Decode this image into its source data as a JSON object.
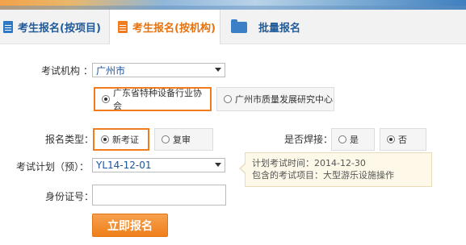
{
  "tabs": [
    {
      "label": "考生报名(按项目)",
      "icon": "document-icon"
    },
    {
      "label": "考生报名(按机构)",
      "icon": "document-icon"
    },
    {
      "label": "批量报名",
      "icon": "folder-icon"
    }
  ],
  "active_tab": 1,
  "form": {
    "institution_label": "考试机构 ：",
    "institution_value": "广州市",
    "orgs": [
      "广东省特种设备行业协会",
      "广州市质量发展研究中心"
    ],
    "selected_org": 0,
    "reg_type_label": "报名类型：",
    "reg_types": [
      "新考证",
      "复审"
    ],
    "selected_reg_type": 0,
    "welding_label": "是否焊接：",
    "welding_options": [
      "是",
      "否"
    ],
    "selected_welding": 1,
    "plan_label": "考试计划（预）：",
    "plan_value": "YL14-12-01",
    "id_label": "身份证号：",
    "id_value": "",
    "submit_label": "立即报名"
  },
  "tooltip": {
    "line1": "计划考试时间：2014-12-30",
    "line2": "包含的考试项目：大型游乐设施操作"
  },
  "colors": {
    "accent": "#f07c1e",
    "link_blue": "#1f5a99"
  }
}
